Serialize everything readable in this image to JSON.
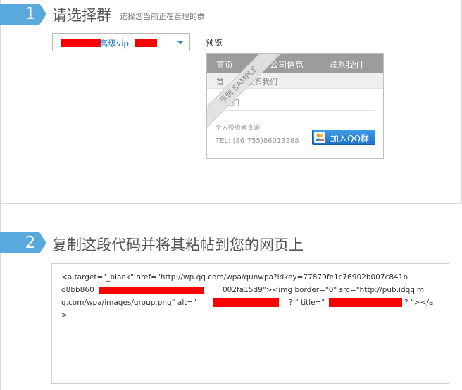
{
  "step1": {
    "number": "1",
    "title": "请选择群",
    "subtitle": "选择您当前正在管理的群"
  },
  "group_select": {
    "selected_value": "高级vip"
  },
  "preview": {
    "label": "预览",
    "nav": [
      "首页",
      "公司信息",
      "联系我们"
    ],
    "subbar": [
      "首",
      "联系我们"
    ],
    "section_title": "系我们",
    "investor_label": "个人投资者查询",
    "tel": "TEL: (86-755)86013388",
    "qq_button_label": "加入QQ群",
    "sample_label": "示例 SAMPLE"
  },
  "step2": {
    "number": "2",
    "title": "复制这段代码并将其粘帖到您的网页上"
  },
  "code": {
    "lines": [
      "<a target=\"_blank\" href=\"http://wp.qq.com/wpa/qunwpa?idkey=77879fe1c76902b007c841b",
      "d8bb860",
      "002fa15d9\"><img border=\"0\" src=\"http://pub.idqqim",
      "g.com/wpa/images/group.png\" alt=\"",
      "? \" title=\"",
      "? \"></a",
      ">"
    ]
  },
  "colors": {
    "badge": "#5aa9dc",
    "accent": "#1a7ac4",
    "redaction": "#ff0000"
  }
}
